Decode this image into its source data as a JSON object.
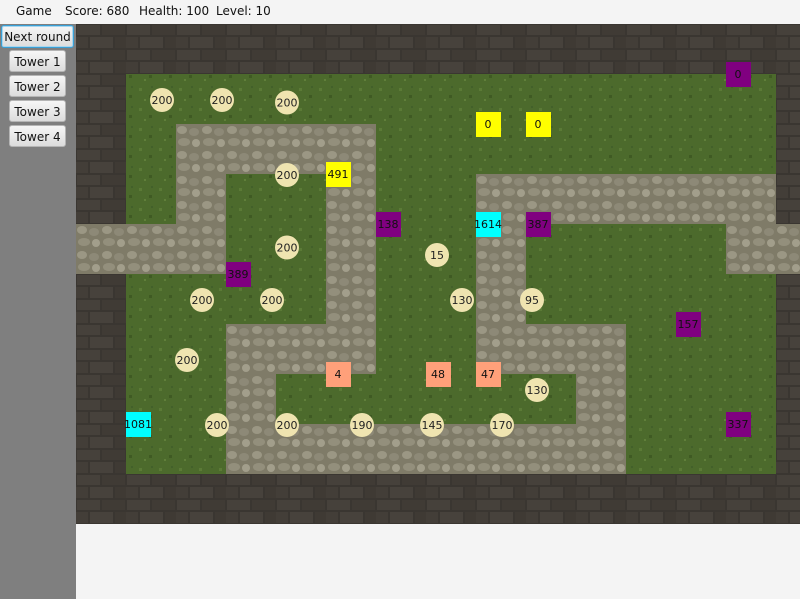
{
  "menubar": {
    "game": "Game",
    "score": "Score: 680",
    "health": "Health: 100",
    "level": "Level: 10"
  },
  "controls": {
    "next_round": "Next round",
    "tower1": "Tower 1",
    "tower2": "Tower 2",
    "tower3": "Tower 3",
    "tower4": "Tower 4"
  },
  "colors": {
    "wall": "#3a3631",
    "grass": "#4c6a2c",
    "path": "#8a8673",
    "enemy": "#efe4b0",
    "tower_yellow": "#ffff00",
    "tower_purple": "#800080",
    "tower_cyan": "#00ffff",
    "tower_salmon": "#ffa07a"
  },
  "enemies": [
    {
      "label": "200",
      "col": 2,
      "row": 2
    },
    {
      "label": "200",
      "col": 3.2,
      "row": 2
    },
    {
      "label": "200",
      "col": 4.5,
      "row": 2.05
    },
    {
      "label": "200",
      "col": 4.5,
      "row": 3.5
    },
    {
      "label": "200",
      "col": 4.5,
      "row": 4.95
    },
    {
      "label": "15",
      "col": 7.5,
      "row": 5.1
    },
    {
      "label": "200",
      "col": 2.8,
      "row": 6
    },
    {
      "label": "200",
      "col": 4.2,
      "row": 6
    },
    {
      "label": "130",
      "col": 8,
      "row": 6
    },
    {
      "label": "95",
      "col": 9.4,
      "row": 6
    },
    {
      "label": "200",
      "col": 2.5,
      "row": 7.2
    },
    {
      "label": "130",
      "col": 9.5,
      "row": 7.8
    },
    {
      "label": "200",
      "col": 3.1,
      "row": 8.5
    },
    {
      "label": "200",
      "col": 4.5,
      "row": 8.5
    },
    {
      "label": "190",
      "col": 6,
      "row": 8.5
    },
    {
      "label": "145",
      "col": 7.4,
      "row": 8.5
    },
    {
      "label": "170",
      "col": 8.8,
      "row": 8.5
    }
  ],
  "towers": [
    {
      "label": "0",
      "type": "purple",
      "col": 13.5,
      "row": 1.5
    },
    {
      "label": "0",
      "type": "yellow",
      "col": 8.5,
      "row": 2.5
    },
    {
      "label": "0",
      "type": "yellow",
      "col": 9.5,
      "row": 2.5
    },
    {
      "label": "491",
      "type": "yellow",
      "col": 5.5,
      "row": 3.5
    },
    {
      "label": "138",
      "type": "purple",
      "col": 6.5,
      "row": 4.5
    },
    {
      "label": "1614",
      "type": "cyan",
      "col": 8.5,
      "row": 4.5
    },
    {
      "label": "387",
      "type": "purple",
      "col": 9.5,
      "row": 4.5
    },
    {
      "label": "389",
      "type": "purple",
      "col": 3.5,
      "row": 5.5
    },
    {
      "label": "157",
      "type": "purple",
      "col": 12.5,
      "row": 6.5
    },
    {
      "label": "4",
      "type": "salmon",
      "col": 5.5,
      "row": 7.5
    },
    {
      "label": "48",
      "type": "salmon",
      "col": 7.5,
      "row": 7.5
    },
    {
      "label": "47",
      "type": "salmon",
      "col": 8.5,
      "row": 7.5
    },
    {
      "label": "1081",
      "type": "cyan",
      "col": 1.5,
      "row": 8.5
    },
    {
      "label": "337",
      "type": "purple",
      "col": 13.5,
      "row": 8.5
    }
  ]
}
